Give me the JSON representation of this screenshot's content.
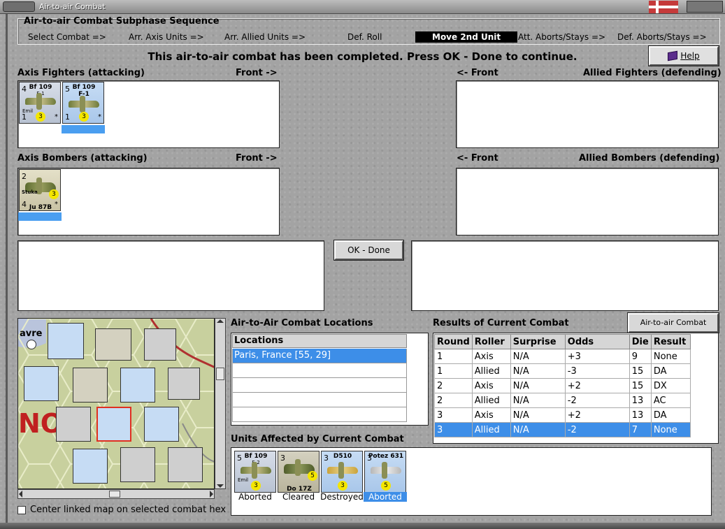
{
  "window": {
    "title": "Air-to-air Combat"
  },
  "sequence": {
    "title": "Air-to-air Combat Subphase Sequence",
    "steps": [
      "Select Combat =>",
      "Arr. Axis Units =>",
      "Arr. Allied Units =>",
      "Def. Roll",
      "Move 2nd Unit",
      "Att. Aborts/Stays =>",
      "Def. Aborts/Stays =>"
    ],
    "active_step": "Move 2nd Unit"
  },
  "status_message": "This air-to-air combat has been completed.  Press OK - Done to continue.",
  "help_label": "Help",
  "panels": {
    "axis_fighters": "Axis Fighters (attacking)",
    "axis_bombers": "Axis Bombers (attacking)",
    "allied_fighters": "Allied Fighters (defending)",
    "allied_bombers": "Allied Bombers (defending)",
    "front_right": "Front ->",
    "front_left": "<- Front"
  },
  "axis_fighters": [
    {
      "name": "Bf 109",
      "variant": "E-1",
      "top": "4",
      "note": "Emil",
      "bottom": "1",
      "rating": "3",
      "star": "*",
      "selected": false
    },
    {
      "name": "Bf 109",
      "variant": "F-1",
      "top": "5",
      "note": "",
      "bottom": "1",
      "rating": "3",
      "star": "*",
      "selected": true
    }
  ],
  "axis_bombers": [
    {
      "top": "2",
      "label": "Stuka",
      "type": "Ju 87B",
      "bottom": "4",
      "rating": "3",
      "star": "*",
      "selected": true
    }
  ],
  "ok_button": "OK - Done",
  "map": {
    "partial_text_left": "avre",
    "big_text": "NO",
    "center_checkbox_label": "Center linked map on selected combat hex"
  },
  "locations": {
    "title": "Air-to-Air Combat Locations",
    "header": "Locations",
    "rows": [
      "Paris, France [55, 29]",
      "",
      "",
      "",
      ""
    ],
    "selected_index": 0
  },
  "results": {
    "title": "Results of Current Combat",
    "chart_button": "Air-to-air Combat Chart",
    "columns": [
      "Round",
      "Roller",
      "Surprise",
      "Odds",
      "Die",
      "Result"
    ],
    "rows": [
      [
        "1",
        "Axis",
        "N/A",
        "+3",
        "9",
        "None"
      ],
      [
        "1",
        "Allied",
        "N/A",
        "-3",
        "15",
        "DA"
      ],
      [
        "2",
        "Axis",
        "N/A",
        "+2",
        "15",
        "DX"
      ],
      [
        "2",
        "Allied",
        "N/A",
        "-2",
        "13",
        "AC"
      ],
      [
        "3",
        "Axis",
        "N/A",
        "+2",
        "13",
        "DA"
      ],
      [
        "3",
        "Allied",
        "N/A",
        "-2",
        "7",
        "None"
      ]
    ],
    "selected_row": 5
  },
  "affected": {
    "title": "Units Affected by Current Combat",
    "units": [
      {
        "name": "Bf 109",
        "variant": "E-2",
        "top": "5",
        "note": "Emil",
        "status": "Aborted",
        "rating": "3"
      },
      {
        "name": "Do 17Z",
        "variant": "",
        "top": "3",
        "note": "",
        "status": "Cleared",
        "rating": "5"
      },
      {
        "name": "D510",
        "variant": "",
        "top": "3",
        "note": "",
        "status": "Destroyed",
        "rating": "3"
      },
      {
        "name": "Potez 631",
        "variant": "",
        "top": "3",
        "note": "",
        "status": "Aborted",
        "rating": "5"
      }
    ],
    "selected_index": 3
  }
}
